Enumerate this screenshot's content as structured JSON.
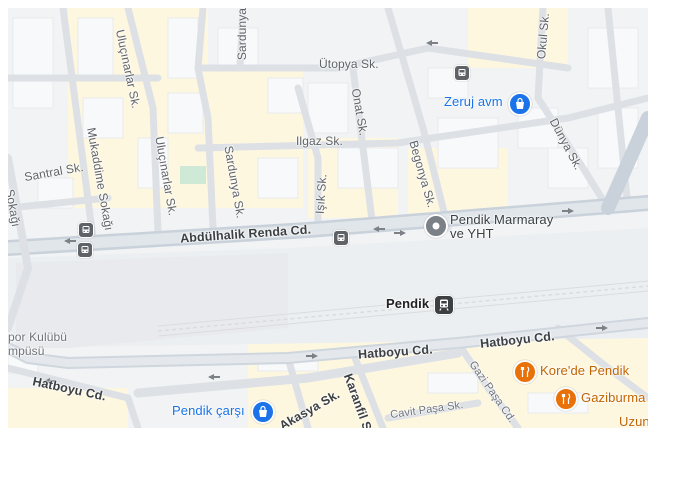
{
  "map": {
    "streets": {
      "utopya": "Ütopya Sk.",
      "okul": "Okul Sk.",
      "sardunya_top": "Sardunya",
      "ulucinarlar_1": "Uluçınarlar Sk.",
      "ulucinarlar_2": "Uluçınarlar Sk.",
      "mukaddime": "Mukaddime Sokağı",
      "onat": "Onat Sk.",
      "begonya": "Begonya Sk.",
      "dunya": "Dünya Sk.",
      "ilgaz": "Ilgaz Sk.",
      "santral": "Santral Sk.",
      "sardunya": "Sardunya Sk.",
      "isik": "Işık Sk.",
      "sokagi_left": "Sokağı",
      "abdulhalik": "Abdülhalik Renda Cd.",
      "hatboyu_1": "Hatboyu Cd.",
      "hatboyu_2": "Hatboyu Cd.",
      "hatboyu_3": "Hatboyu Cd.",
      "akasya": "Akasya Sk.",
      "karanfil": "Karanfil S",
      "cavit_pasa": "Cavit Paşa Sk.",
      "gazi_pasa": "Gazi Paşa Cd."
    },
    "places": {
      "zeruj": "Zeruj avm",
      "pendik_marmaray_1": "Pendik Marmaray",
      "pendik_marmaray_2": "ve YHT",
      "pendik_station": "Pendik",
      "pendik_carsi": "Pendik çarşı",
      "kore_de_pendik": "Kore'de Pendik",
      "gaziburma": "Gaziburma",
      "uzun": "Uzun",
      "spor_kulubu": "por Kulübü",
      "kampusu": "mpüsü"
    },
    "icons": {
      "shopping": "shopping-bag-icon",
      "restaurant": "fork-knife-icon",
      "transit": "bus-icon",
      "train": "train-icon",
      "landmark": "landmark-pin-icon"
    },
    "colors": {
      "background": "#f1f3f4",
      "block": "#f8f9fa",
      "commercial": "#fef7e0",
      "road": "#dde1e5",
      "major_road": "#c9d1da",
      "park": "#ceead6",
      "poi_blue": "#1a73e8",
      "poi_orange": "#e8710a"
    }
  }
}
